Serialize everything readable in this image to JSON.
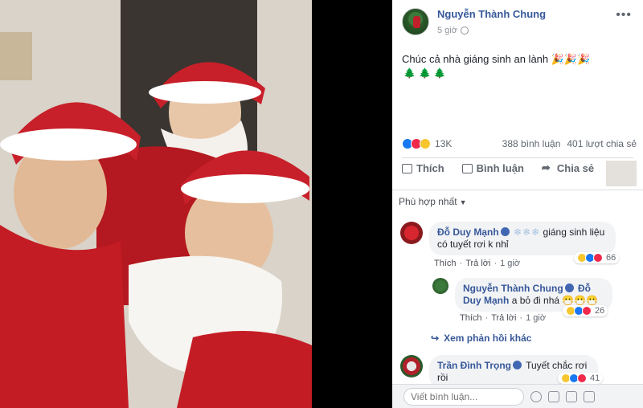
{
  "post": {
    "author": "Nguyễn Thành Chung",
    "time": "5 giờ",
    "text": "Chúc cả nhà giáng sinh an lành 🎉🎉🎉",
    "emoji_line": "🌲🌲🌲",
    "reaction_count": "13K",
    "comments": "388 bình luận",
    "shares": "401 lượt chia sẻ"
  },
  "actions": {
    "like": "Thích",
    "comment": "Bình luận",
    "share": "Chia sẻ"
  },
  "sort": {
    "label": "Phù hợp nhất"
  },
  "comments": [
    {
      "name": "Đỗ Duy Mạnh",
      "text": "giáng sinh liệu có tuyết rơi k nhỉ",
      "snow": "❄❄❄",
      "like": "Thích",
      "reply": "Trả lời",
      "time": "1 giờ",
      "reactions": "66"
    },
    {
      "name": "Nguyễn Thành Chung",
      "mention": "Đỗ Duy Mạnh",
      "text": "a bỏ đi nhá 😷😷😷",
      "like": "Thích",
      "reply": "Trả lời",
      "time": "1 giờ",
      "reactions": "26"
    },
    {
      "name": "Trần Đình Trọng",
      "text": "Tuyết chắc rơi rồi",
      "reactions": "41"
    }
  ],
  "more_replies": "Xem phản hồi khác",
  "compose": {
    "placeholder": "Viết bình luận..."
  },
  "colors": {
    "link": "#365899",
    "santa_red": "#c8202a"
  }
}
